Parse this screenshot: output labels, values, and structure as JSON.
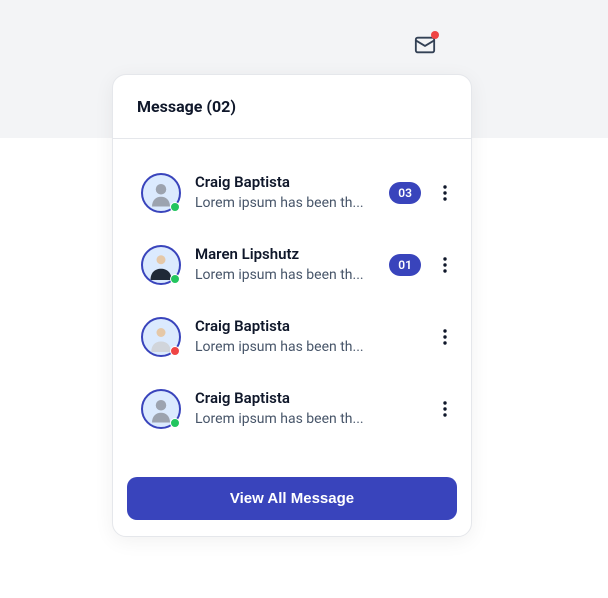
{
  "header": {
    "title": "Message (02)"
  },
  "messages": [
    {
      "name": "Craig Baptista",
      "preview": "Lorem ipsum has been th...",
      "count": "03",
      "status": "online"
    },
    {
      "name": "Maren Lipshutz",
      "preview": "Lorem ipsum has been th...",
      "count": "01",
      "status": "online"
    },
    {
      "name": "Craig Baptista",
      "preview": "Lorem ipsum has been th...",
      "count": "",
      "status": "busy"
    },
    {
      "name": "Craig Baptista",
      "preview": "Lorem ipsum has been th...",
      "count": "",
      "status": "online"
    }
  ],
  "footer": {
    "viewAll": "View All Message"
  }
}
